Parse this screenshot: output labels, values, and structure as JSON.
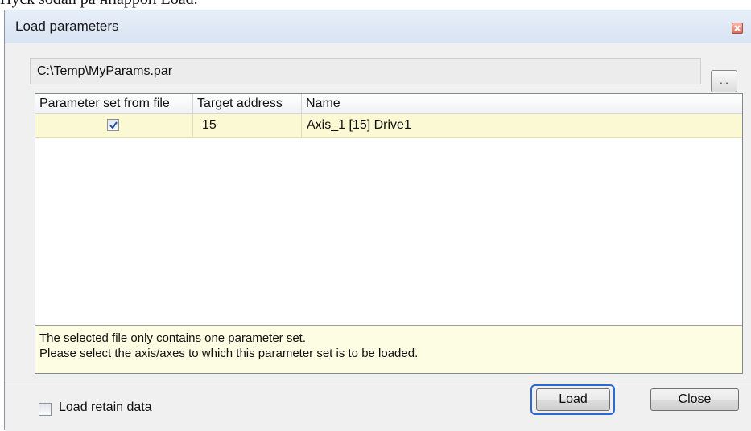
{
  "page_caption": "Нуск sodan på нпарроп Load.",
  "dialog": {
    "title": "Load parameters",
    "close_icon": "close-icon"
  },
  "file": {
    "path": "C:\\Temp\\MyParams.par",
    "browse_label": "..."
  },
  "grid": {
    "columns": [
      "Parameter set from file",
      "Target address",
      "Name"
    ],
    "rows": [
      {
        "selected": true,
        "target_address": "15",
        "name": "Axis_1 [15] Drive1"
      }
    ],
    "info_lines": [
      "The selected file only contains one parameter set.",
      "Please select the axis/axes to which this parameter set is to be loaded."
    ]
  },
  "footer": {
    "retain_label": "Load retain data",
    "retain_checked": false,
    "load_label": "Load",
    "close_label": "Close"
  },
  "colors": {
    "row_highlight": "#fbf9d3",
    "focus_ring": "#2a6ad6"
  }
}
